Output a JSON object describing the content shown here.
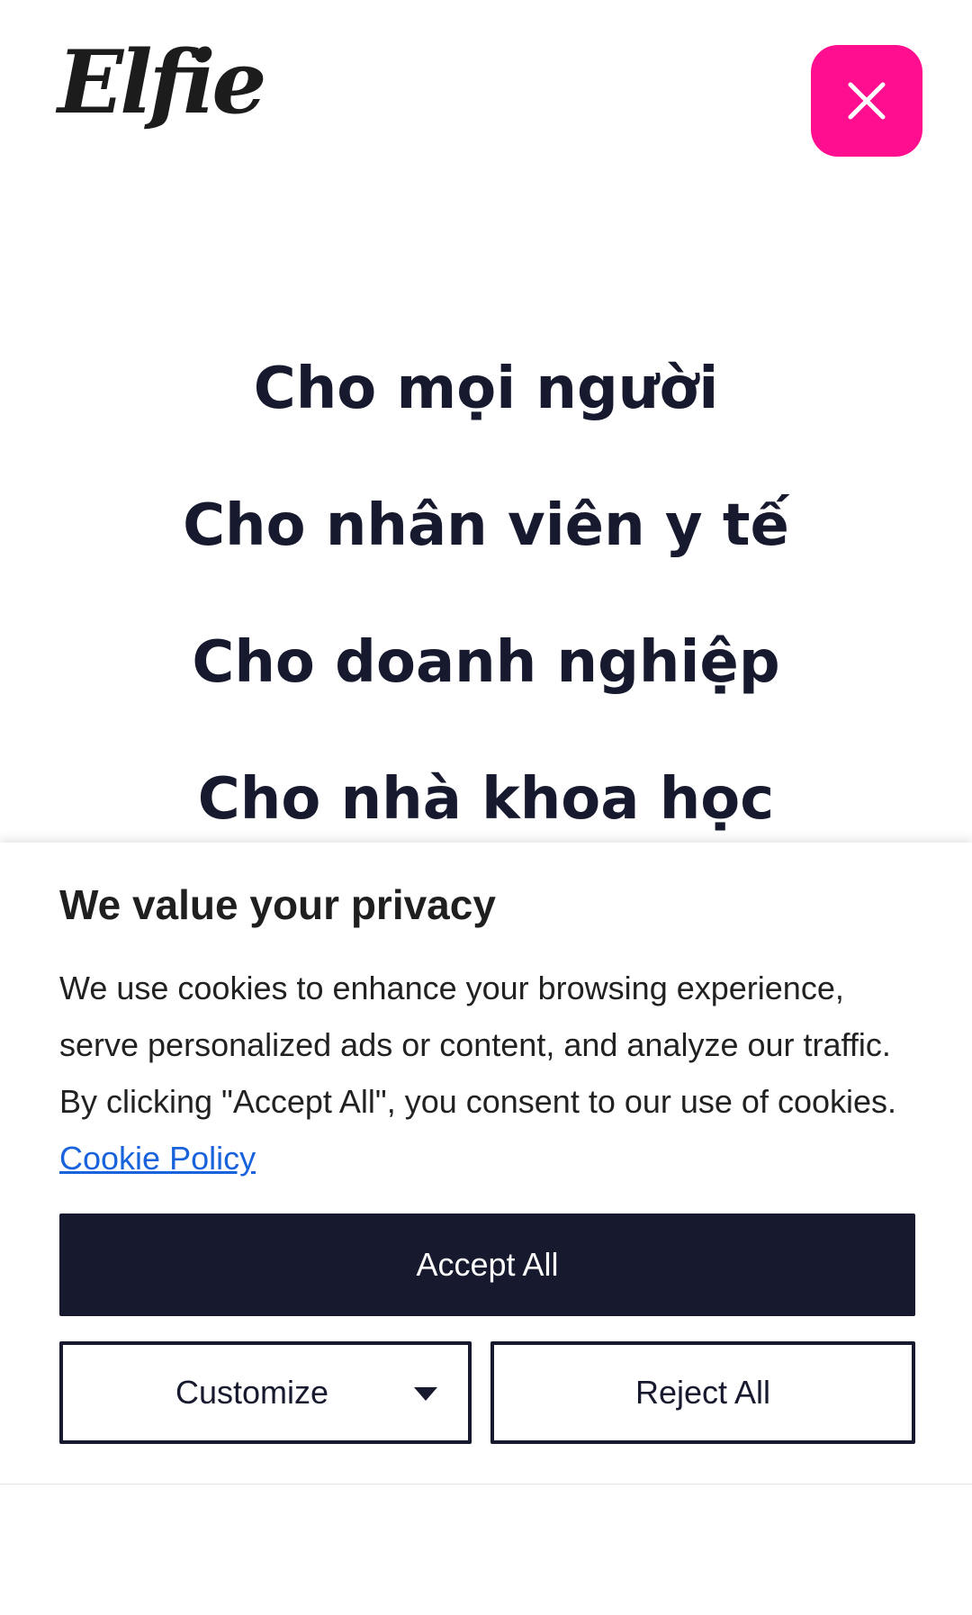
{
  "header": {
    "logo_text": "Elfie",
    "close_icon": "close-icon"
  },
  "nav": {
    "items": [
      {
        "label": "Cho mọi người"
      },
      {
        "label": "Cho nhân viên y tế"
      },
      {
        "label": "Cho doanh nghiệp"
      },
      {
        "label": "Cho nhà khoa học"
      }
    ]
  },
  "cookie_banner": {
    "title": "We value your privacy",
    "body": "We use cookies to enhance your browsing experience, serve personalized ads or content, and analyze our traffic. By clicking \"Accept All\", you consent to our use of cookies.",
    "policy_link": "Cookie Policy",
    "accept_label": "Accept All",
    "customize_label": "Customize",
    "reject_label": "Reject All"
  },
  "colors": {
    "accent": "#ff0f8f",
    "dark": "#171a2e",
    "link": "#1863dc"
  }
}
